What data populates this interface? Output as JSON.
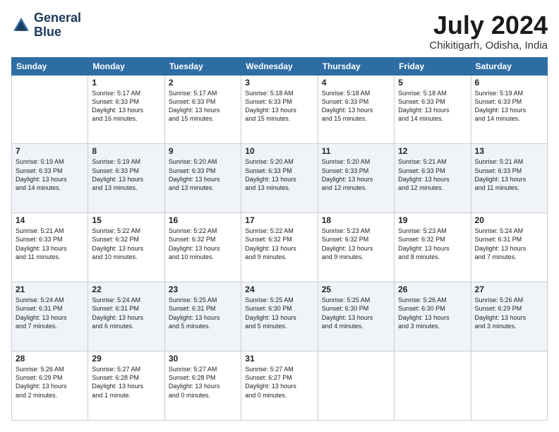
{
  "logo": {
    "line1": "General",
    "line2": "Blue"
  },
  "title": "July 2024",
  "location": "Chikitigarh, Odisha, India",
  "days_of_week": [
    "Sunday",
    "Monday",
    "Tuesday",
    "Wednesday",
    "Thursday",
    "Friday",
    "Saturday"
  ],
  "weeks": [
    [
      {
        "day": "",
        "info": ""
      },
      {
        "day": "1",
        "info": "Sunrise: 5:17 AM\nSunset: 6:33 PM\nDaylight: 13 hours\nand 16 minutes."
      },
      {
        "day": "2",
        "info": "Sunrise: 5:17 AM\nSunset: 6:33 PM\nDaylight: 13 hours\nand 15 minutes."
      },
      {
        "day": "3",
        "info": "Sunrise: 5:18 AM\nSunset: 6:33 PM\nDaylight: 13 hours\nand 15 minutes."
      },
      {
        "day": "4",
        "info": "Sunrise: 5:18 AM\nSunset: 6:33 PM\nDaylight: 13 hours\nand 15 minutes."
      },
      {
        "day": "5",
        "info": "Sunrise: 5:18 AM\nSunset: 6:33 PM\nDaylight: 13 hours\nand 14 minutes."
      },
      {
        "day": "6",
        "info": "Sunrise: 5:19 AM\nSunset: 6:33 PM\nDaylight: 13 hours\nand 14 minutes."
      }
    ],
    [
      {
        "day": "7",
        "info": "Sunrise: 5:19 AM\nSunset: 6:33 PM\nDaylight: 13 hours\nand 14 minutes."
      },
      {
        "day": "8",
        "info": "Sunrise: 5:19 AM\nSunset: 6:33 PM\nDaylight: 13 hours\nand 13 minutes."
      },
      {
        "day": "9",
        "info": "Sunrise: 5:20 AM\nSunset: 6:33 PM\nDaylight: 13 hours\nand 13 minutes."
      },
      {
        "day": "10",
        "info": "Sunrise: 5:20 AM\nSunset: 6:33 PM\nDaylight: 13 hours\nand 13 minutes."
      },
      {
        "day": "11",
        "info": "Sunrise: 5:20 AM\nSunset: 6:33 PM\nDaylight: 13 hours\nand 12 minutes."
      },
      {
        "day": "12",
        "info": "Sunrise: 5:21 AM\nSunset: 6:33 PM\nDaylight: 13 hours\nand 12 minutes."
      },
      {
        "day": "13",
        "info": "Sunrise: 5:21 AM\nSunset: 6:33 PM\nDaylight: 13 hours\nand 11 minutes."
      }
    ],
    [
      {
        "day": "14",
        "info": "Sunrise: 5:21 AM\nSunset: 6:33 PM\nDaylight: 13 hours\nand 11 minutes."
      },
      {
        "day": "15",
        "info": "Sunrise: 5:22 AM\nSunset: 6:32 PM\nDaylight: 13 hours\nand 10 minutes."
      },
      {
        "day": "16",
        "info": "Sunrise: 5:22 AM\nSunset: 6:32 PM\nDaylight: 13 hours\nand 10 minutes."
      },
      {
        "day": "17",
        "info": "Sunrise: 5:22 AM\nSunset: 6:32 PM\nDaylight: 13 hours\nand 9 minutes."
      },
      {
        "day": "18",
        "info": "Sunrise: 5:23 AM\nSunset: 6:32 PM\nDaylight: 13 hours\nand 9 minutes."
      },
      {
        "day": "19",
        "info": "Sunrise: 5:23 AM\nSunset: 6:32 PM\nDaylight: 13 hours\nand 8 minutes."
      },
      {
        "day": "20",
        "info": "Sunrise: 5:24 AM\nSunset: 6:31 PM\nDaylight: 13 hours\nand 7 minutes."
      }
    ],
    [
      {
        "day": "21",
        "info": "Sunrise: 5:24 AM\nSunset: 6:31 PM\nDaylight: 13 hours\nand 7 minutes."
      },
      {
        "day": "22",
        "info": "Sunrise: 5:24 AM\nSunset: 6:31 PM\nDaylight: 13 hours\nand 6 minutes."
      },
      {
        "day": "23",
        "info": "Sunrise: 5:25 AM\nSunset: 6:31 PM\nDaylight: 13 hours\nand 5 minutes."
      },
      {
        "day": "24",
        "info": "Sunrise: 5:25 AM\nSunset: 6:30 PM\nDaylight: 13 hours\nand 5 minutes."
      },
      {
        "day": "25",
        "info": "Sunrise: 5:25 AM\nSunset: 6:30 PM\nDaylight: 13 hours\nand 4 minutes."
      },
      {
        "day": "26",
        "info": "Sunrise: 5:26 AM\nSunset: 6:30 PM\nDaylight: 13 hours\nand 3 minutes."
      },
      {
        "day": "27",
        "info": "Sunrise: 5:26 AM\nSunset: 6:29 PM\nDaylight: 13 hours\nand 3 minutes."
      }
    ],
    [
      {
        "day": "28",
        "info": "Sunrise: 5:26 AM\nSunset: 6:29 PM\nDaylight: 13 hours\nand 2 minutes."
      },
      {
        "day": "29",
        "info": "Sunrise: 5:27 AM\nSunset: 6:28 PM\nDaylight: 13 hours\nand 1 minute."
      },
      {
        "day": "30",
        "info": "Sunrise: 5:27 AM\nSunset: 6:28 PM\nDaylight: 13 hours\nand 0 minutes."
      },
      {
        "day": "31",
        "info": "Sunrise: 5:27 AM\nSunset: 6:27 PM\nDaylight: 13 hours\nand 0 minutes."
      },
      {
        "day": "",
        "info": ""
      },
      {
        "day": "",
        "info": ""
      },
      {
        "day": "",
        "info": ""
      }
    ]
  ]
}
